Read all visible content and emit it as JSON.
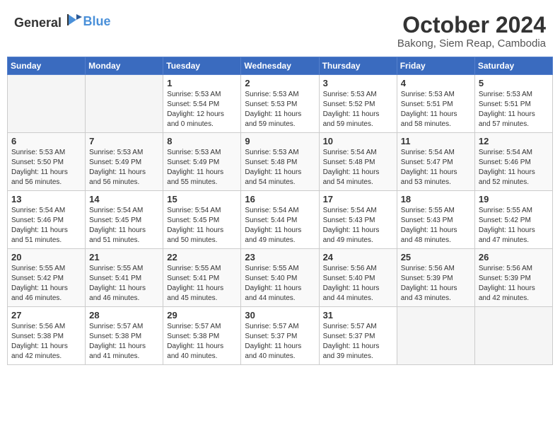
{
  "header": {
    "logo": {
      "text_general": "General",
      "text_blue": "Blue"
    },
    "month": "October 2024",
    "location": "Bakong, Siem Reap, Cambodia"
  },
  "days_of_week": [
    "Sunday",
    "Monday",
    "Tuesday",
    "Wednesday",
    "Thursday",
    "Friday",
    "Saturday"
  ],
  "weeks": [
    [
      {
        "day": "",
        "sunrise": "",
        "sunset": "",
        "daylight": "",
        "empty": true
      },
      {
        "day": "",
        "sunrise": "",
        "sunset": "",
        "daylight": "",
        "empty": true
      },
      {
        "day": "1",
        "sunrise": "Sunrise: 5:53 AM",
        "sunset": "Sunset: 5:54 PM",
        "daylight": "Daylight: 12 hours and 0 minutes.",
        "empty": false
      },
      {
        "day": "2",
        "sunrise": "Sunrise: 5:53 AM",
        "sunset": "Sunset: 5:53 PM",
        "daylight": "Daylight: 11 hours and 59 minutes.",
        "empty": false
      },
      {
        "day": "3",
        "sunrise": "Sunrise: 5:53 AM",
        "sunset": "Sunset: 5:52 PM",
        "daylight": "Daylight: 11 hours and 59 minutes.",
        "empty": false
      },
      {
        "day": "4",
        "sunrise": "Sunrise: 5:53 AM",
        "sunset": "Sunset: 5:51 PM",
        "daylight": "Daylight: 11 hours and 58 minutes.",
        "empty": false
      },
      {
        "day": "5",
        "sunrise": "Sunrise: 5:53 AM",
        "sunset": "Sunset: 5:51 PM",
        "daylight": "Daylight: 11 hours and 57 minutes.",
        "empty": false
      }
    ],
    [
      {
        "day": "6",
        "sunrise": "Sunrise: 5:53 AM",
        "sunset": "Sunset: 5:50 PM",
        "daylight": "Daylight: 11 hours and 56 minutes.",
        "empty": false
      },
      {
        "day": "7",
        "sunrise": "Sunrise: 5:53 AM",
        "sunset": "Sunset: 5:49 PM",
        "daylight": "Daylight: 11 hours and 56 minutes.",
        "empty": false
      },
      {
        "day": "8",
        "sunrise": "Sunrise: 5:53 AM",
        "sunset": "Sunset: 5:49 PM",
        "daylight": "Daylight: 11 hours and 55 minutes.",
        "empty": false
      },
      {
        "day": "9",
        "sunrise": "Sunrise: 5:53 AM",
        "sunset": "Sunset: 5:48 PM",
        "daylight": "Daylight: 11 hours and 54 minutes.",
        "empty": false
      },
      {
        "day": "10",
        "sunrise": "Sunrise: 5:54 AM",
        "sunset": "Sunset: 5:48 PM",
        "daylight": "Daylight: 11 hours and 54 minutes.",
        "empty": false
      },
      {
        "day": "11",
        "sunrise": "Sunrise: 5:54 AM",
        "sunset": "Sunset: 5:47 PM",
        "daylight": "Daylight: 11 hours and 53 minutes.",
        "empty": false
      },
      {
        "day": "12",
        "sunrise": "Sunrise: 5:54 AM",
        "sunset": "Sunset: 5:46 PM",
        "daylight": "Daylight: 11 hours and 52 minutes.",
        "empty": false
      }
    ],
    [
      {
        "day": "13",
        "sunrise": "Sunrise: 5:54 AM",
        "sunset": "Sunset: 5:46 PM",
        "daylight": "Daylight: 11 hours and 51 minutes.",
        "empty": false
      },
      {
        "day": "14",
        "sunrise": "Sunrise: 5:54 AM",
        "sunset": "Sunset: 5:45 PM",
        "daylight": "Daylight: 11 hours and 51 minutes.",
        "empty": false
      },
      {
        "day": "15",
        "sunrise": "Sunrise: 5:54 AM",
        "sunset": "Sunset: 5:45 PM",
        "daylight": "Daylight: 11 hours and 50 minutes.",
        "empty": false
      },
      {
        "day": "16",
        "sunrise": "Sunrise: 5:54 AM",
        "sunset": "Sunset: 5:44 PM",
        "daylight": "Daylight: 11 hours and 49 minutes.",
        "empty": false
      },
      {
        "day": "17",
        "sunrise": "Sunrise: 5:54 AM",
        "sunset": "Sunset: 5:43 PM",
        "daylight": "Daylight: 11 hours and 49 minutes.",
        "empty": false
      },
      {
        "day": "18",
        "sunrise": "Sunrise: 5:55 AM",
        "sunset": "Sunset: 5:43 PM",
        "daylight": "Daylight: 11 hours and 48 minutes.",
        "empty": false
      },
      {
        "day": "19",
        "sunrise": "Sunrise: 5:55 AM",
        "sunset": "Sunset: 5:42 PM",
        "daylight": "Daylight: 11 hours and 47 minutes.",
        "empty": false
      }
    ],
    [
      {
        "day": "20",
        "sunrise": "Sunrise: 5:55 AM",
        "sunset": "Sunset: 5:42 PM",
        "daylight": "Daylight: 11 hours and 46 minutes.",
        "empty": false
      },
      {
        "day": "21",
        "sunrise": "Sunrise: 5:55 AM",
        "sunset": "Sunset: 5:41 PM",
        "daylight": "Daylight: 11 hours and 46 minutes.",
        "empty": false
      },
      {
        "day": "22",
        "sunrise": "Sunrise: 5:55 AM",
        "sunset": "Sunset: 5:41 PM",
        "daylight": "Daylight: 11 hours and 45 minutes.",
        "empty": false
      },
      {
        "day": "23",
        "sunrise": "Sunrise: 5:55 AM",
        "sunset": "Sunset: 5:40 PM",
        "daylight": "Daylight: 11 hours and 44 minutes.",
        "empty": false
      },
      {
        "day": "24",
        "sunrise": "Sunrise: 5:56 AM",
        "sunset": "Sunset: 5:40 PM",
        "daylight": "Daylight: 11 hours and 44 minutes.",
        "empty": false
      },
      {
        "day": "25",
        "sunrise": "Sunrise: 5:56 AM",
        "sunset": "Sunset: 5:39 PM",
        "daylight": "Daylight: 11 hours and 43 minutes.",
        "empty": false
      },
      {
        "day": "26",
        "sunrise": "Sunrise: 5:56 AM",
        "sunset": "Sunset: 5:39 PM",
        "daylight": "Daylight: 11 hours and 42 minutes.",
        "empty": false
      }
    ],
    [
      {
        "day": "27",
        "sunrise": "Sunrise: 5:56 AM",
        "sunset": "Sunset: 5:38 PM",
        "daylight": "Daylight: 11 hours and 42 minutes.",
        "empty": false
      },
      {
        "day": "28",
        "sunrise": "Sunrise: 5:57 AM",
        "sunset": "Sunset: 5:38 PM",
        "daylight": "Daylight: 11 hours and 41 minutes.",
        "empty": false
      },
      {
        "day": "29",
        "sunrise": "Sunrise: 5:57 AM",
        "sunset": "Sunset: 5:38 PM",
        "daylight": "Daylight: 11 hours and 40 minutes.",
        "empty": false
      },
      {
        "day": "30",
        "sunrise": "Sunrise: 5:57 AM",
        "sunset": "Sunset: 5:37 PM",
        "daylight": "Daylight: 11 hours and 40 minutes.",
        "empty": false
      },
      {
        "day": "31",
        "sunrise": "Sunrise: 5:57 AM",
        "sunset": "Sunset: 5:37 PM",
        "daylight": "Daylight: 11 hours and 39 minutes.",
        "empty": false
      },
      {
        "day": "",
        "sunrise": "",
        "sunset": "",
        "daylight": "",
        "empty": true
      },
      {
        "day": "",
        "sunrise": "",
        "sunset": "",
        "daylight": "",
        "empty": true
      }
    ]
  ]
}
